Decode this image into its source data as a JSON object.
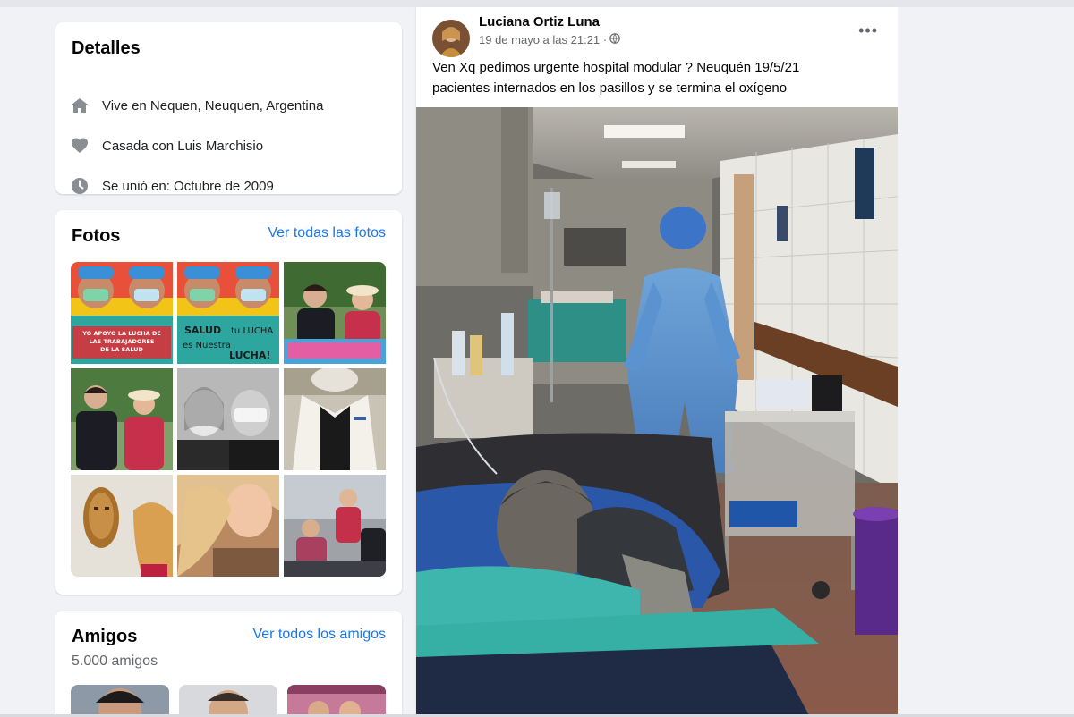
{
  "details": {
    "title": "Detalles",
    "lives": "Vive en Nequen, Neuquen, Argentina",
    "relationship": "Casada con Luis Marchisio",
    "joined": "Se unió en: Octubre de 2009",
    "icons": [
      "home-icon",
      "heart-icon",
      "clock-icon"
    ]
  },
  "photos": {
    "title": "Fotos",
    "see_all": "Ver todas las fotos",
    "captions": {
      "p1": "YO APOYO LA LUCHA DE LAS TRABAJADORES DE LA SALUD",
      "p2": "SALUD tu LUCHA es Nuestra LUCHA!"
    }
  },
  "friends": {
    "title": "Amigos",
    "see_all": "Ver todos los amigos",
    "count": "5.000 amigos"
  },
  "post": {
    "author": "Luciana Ortiz Luna",
    "date": "19 de mayo a las 21:21 ·",
    "more": "•••",
    "text_line1": "Ven Xq pedimos urgente hospital modular ? Neuquén 19/5/21",
    "text_line2": "pacientes internados en los pasillos y se termina el oxígeno"
  },
  "colors": {
    "background": "#f0f2f5",
    "card": "#ffffff",
    "link": "#1877f2",
    "secondary_text": "#65676b"
  }
}
